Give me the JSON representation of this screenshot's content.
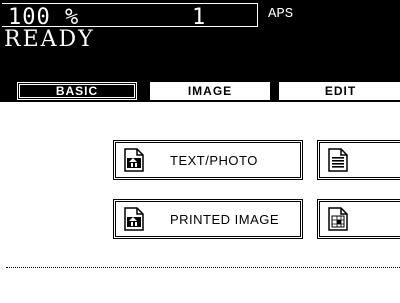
{
  "header": {
    "zoom": "100  %",
    "copy_count": "1",
    "paper_mode": "APS",
    "status": "READY"
  },
  "tabs": [
    {
      "label": "BASIC",
      "active": true
    },
    {
      "label": "IMAGE",
      "active": false
    },
    {
      "label": "EDIT",
      "active": false
    }
  ],
  "original_mode": {
    "text_photo_label": "TEXT/PHOTO",
    "printed_image_label": "PRINTED IMAGE"
  },
  "colors": {
    "background": "#ffffff",
    "foreground": "#000000"
  }
}
